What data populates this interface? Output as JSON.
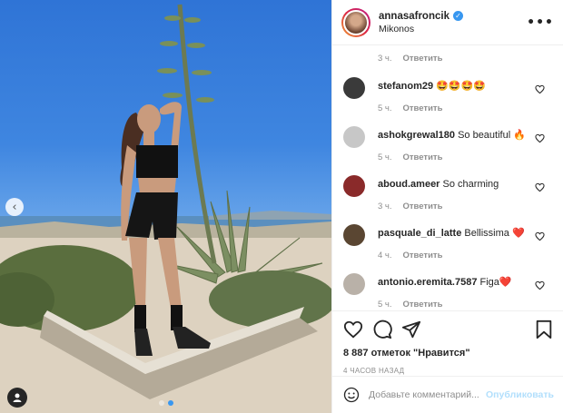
{
  "header": {
    "username": "annasafroncik",
    "location": "Mikonos"
  },
  "comments": {
    "top_meta": {
      "time": "3 ч.",
      "reply": "Ответить"
    },
    "items": [
      {
        "user": "stefanom29",
        "text": "🤩🤩🤩🤩",
        "time": "5 ч.",
        "reply": "Ответить",
        "avatar_color": "#3a3a3a"
      },
      {
        "user": "ashokgrewal180",
        "text": "So beautiful 🔥",
        "time": "5 ч.",
        "reply": "Ответить",
        "avatar_color": "#c7c7c7"
      },
      {
        "user": "aboud.ameer",
        "text": "So charming",
        "time": "3 ч.",
        "reply": "Ответить",
        "avatar_color": "#8a2a2a"
      },
      {
        "user": "pasquale_di_latte",
        "text": "Bellissima ❤️",
        "time": "4 ч.",
        "reply": "Ответить",
        "avatar_color": "#5a4632"
      },
      {
        "user": "antonio.eremita.7587",
        "text": "Figa❤️",
        "time": "5 ч.",
        "reply": "Ответить",
        "avatar_color": "#b9b1a8"
      }
    ]
  },
  "actions": {
    "likes": "8 887 отметок \"Нравится\"",
    "time_ago": "4 ЧАСОВ НАЗАД"
  },
  "add_comment": {
    "placeholder": "Добавьте комментарий...",
    "post_label": "Опубликовать"
  },
  "carousel": {
    "total": 2,
    "active": 1
  },
  "colors": {
    "accent": "#3897f0",
    "muted": "#8e8e8e",
    "text": "#262626",
    "post_disabled": "#b2dffc"
  }
}
